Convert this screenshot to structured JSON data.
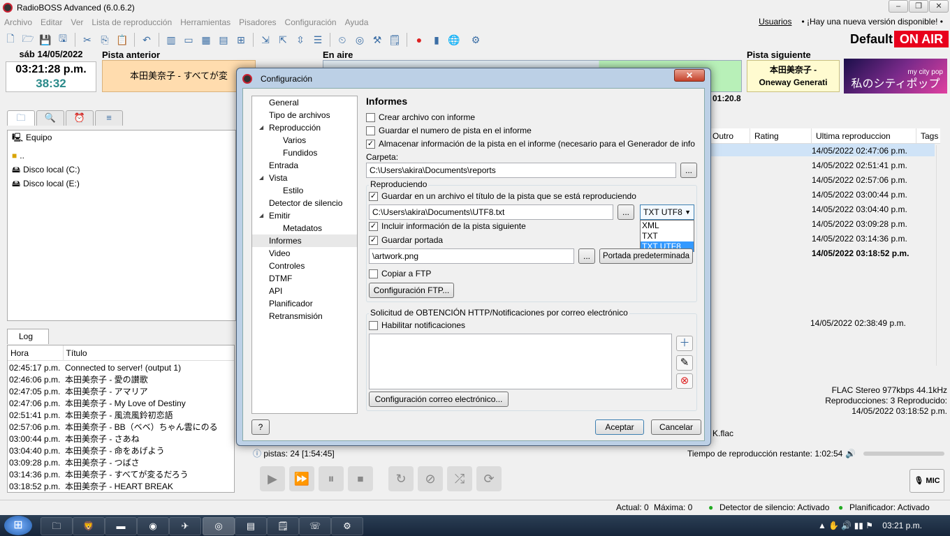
{
  "app": {
    "title": "RadioBOSS Advanced (6.0.6.2)",
    "on_air_label": "Default",
    "on_air": "ON AIR",
    "users": "Usuarios",
    "update_notice": "• ¡Hay una nueva versión disponible! •"
  },
  "menu": [
    "Archivo",
    "Editar",
    "Ver",
    "Lista de reproducción",
    "Herramientas",
    "Pisadores",
    "Configuración",
    "Ayuda"
  ],
  "header": {
    "date": "sáb 14/05/2022",
    "time": "03:21:28 p.m.",
    "remaining": "38:32",
    "prev_label": "Pista anterior",
    "prev_track": "本田美奈子 - すべてが変",
    "onair_label": "En aire",
    "next_label": "Pista siguiente",
    "next_track_1": "本田美奈子 -",
    "next_track_2": "Oneway Generati",
    "time_right": "01:20.8",
    "cover_text": "私のシティポップ",
    "cover_small": "my city pop"
  },
  "browser": {
    "root": "Equipo",
    "items": [
      "..",
      "Disco local (C:)",
      "Disco local  (E:)"
    ]
  },
  "log": {
    "tab": "Log",
    "col_hora": "Hora",
    "col_titulo": "Título",
    "rows": [
      {
        "h": "02:45:17 p.m.",
        "t": "Connected to server! (output 1)"
      },
      {
        "h": "02:46:06 p.m.",
        "t": "本田美奈子 - 愛の讃歌"
      },
      {
        "h": "02:47:05 p.m.",
        "t": "本田美奈子 - アマリア"
      },
      {
        "h": "02:47:06 p.m.",
        "t": "本田美奈子 - My Love of Destiny"
      },
      {
        "h": "02:51:41 p.m.",
        "t": "本田美奈子 - 風流風鈴初恋語"
      },
      {
        "h": "02:57:06 p.m.",
        "t": "本田美奈子 - BB（ベベ）ちゃん雲にのる"
      },
      {
        "h": "03:00:44 p.m.",
        "t": "本田美奈子 - さあね"
      },
      {
        "h": "03:04:40 p.m.",
        "t": "本田美奈子 - 命をあげよう"
      },
      {
        "h": "03:09:28 p.m.",
        "t": "本田美奈子 - つばさ"
      },
      {
        "h": "03:14:36 p.m.",
        "t": "本田美奈子 - すべてが変るだろう"
      },
      {
        "h": "03:18:52 p.m.",
        "t": "本田美奈子 - HEART BREAK"
      }
    ]
  },
  "playlist": {
    "cols": [
      "Outro",
      "Rating",
      "Ultima reproduccion",
      "Tags"
    ],
    "dates": [
      "14/05/2022 02:47:06 p.m.",
      "14/05/2022 02:51:41 p.m.",
      "14/05/2022 02:57:06 p.m.",
      "14/05/2022 03:00:44 p.m.",
      "14/05/2022 03:04:40 p.m.",
      "14/05/2022 03:09:28 p.m.",
      "14/05/2022 03:14:36 p.m.",
      "14/05/2022 03:18:52 p.m."
    ],
    "date_extra": "14/05/2022 02:38:49 p.m.",
    "info1": "FLAC Stereo 977kbps 44.1kHz",
    "info2": "Reproducciones: 3  Reproducido:",
    "info3": "14/05/2022 03:18:52 p.m.",
    "info4": "K.flac",
    "count": "pistas: 24 [1:54:45]",
    "remaining": "Tiempo de reproducción restante: 1:02:54",
    "mic": "MIC"
  },
  "statusbar": {
    "actual": "Actual: 0",
    "maxima": "Máxima: 0",
    "detector": "Detector de silencio: Activado",
    "planificador": "Planificador: Activado"
  },
  "taskbar": {
    "time": "03:21 p.m."
  },
  "dialog": {
    "title": "Configuración",
    "nav": [
      {
        "label": "General",
        "level": 0
      },
      {
        "label": "Tipo de archivos",
        "level": 0
      },
      {
        "label": "Reproducción",
        "level": 0,
        "exp": true
      },
      {
        "label": "Varios",
        "level": 1
      },
      {
        "label": "Fundidos",
        "level": 1
      },
      {
        "label": "Entrada",
        "level": 0
      },
      {
        "label": "Vista",
        "level": 0,
        "exp": true
      },
      {
        "label": "Estilo",
        "level": 1
      },
      {
        "label": "Detector de silencio",
        "level": 0
      },
      {
        "label": "Emitir",
        "level": 0,
        "exp": true
      },
      {
        "label": "Metadatos",
        "level": 1
      },
      {
        "label": "Informes",
        "level": 0,
        "sel": true
      },
      {
        "label": "Video",
        "level": 0
      },
      {
        "label": "Controles",
        "level": 0
      },
      {
        "label": "DTMF",
        "level": 0
      },
      {
        "label": "API",
        "level": 0
      },
      {
        "label": "Planificador",
        "level": 0
      },
      {
        "label": "Retransmisión",
        "level": 0
      }
    ],
    "section": "Informes",
    "cb_crear": "Crear archivo con informe",
    "cb_numero": "Guardar el numero de pista en el informe",
    "cb_almacenar": "Almacenar información de la pista en el informe  (necesario para el Generador de info",
    "carpeta_label": "Carpeta:",
    "carpeta_value": "C:\\Users\\akira\\Documents\\reports",
    "browse": "...",
    "repro_group": "Reproduciendo",
    "cb_guardar_titulo": "Guardar en un archivo el título de la pista que se está reproduciendo",
    "file_value": "C:\\Users\\akira\\Documents\\UTF8.txt",
    "format_selected": "TXT UTF8",
    "format_options": [
      "XML",
      "TXT",
      "TXT UTF8"
    ],
    "cb_incluir": "Incluir información de la pista siguiente",
    "cb_portada": "Guardar portada",
    "artwork_value": "\\artwork.png",
    "portada_btn": "Portada predeterminada",
    "cb_ftp": "Copiar a FTP",
    "ftp_btn": "Configuración FTP...",
    "http_group": "Solicitud de OBTENCIÓN HTTP/Notificaciones por correo electrónico",
    "cb_notif": "Habilitar notificaciones",
    "email_btn": "Configuración correo electrónico...",
    "help": "?",
    "ok": "Aceptar",
    "cancel": "Cancelar"
  }
}
